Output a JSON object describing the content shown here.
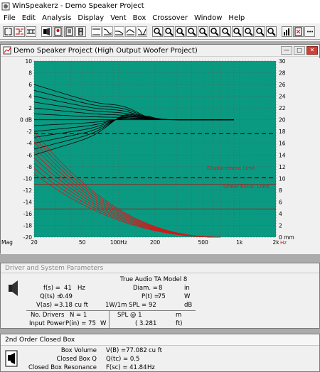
{
  "app": {
    "title": "WinSpeakerz - Demo Speaker Project"
  },
  "menu": [
    "File",
    "Edit",
    "Analysis",
    "Display",
    "Vent",
    "Box",
    "Crossover",
    "Window",
    "Help"
  ],
  "graph": {
    "window_title": "Demo Speaker Project (High Output Woofer Project)",
    "left_ticks": [
      "10",
      "8",
      "6",
      "4",
      "2",
      "0 dB",
      "-2",
      "-4",
      "-6",
      "-8",
      "-10",
      "-12",
      "-14",
      "-16",
      "-18",
      "-20"
    ],
    "left_bottom_label": "Mag",
    "right_ticks": [
      "30",
      "28",
      "26",
      "24",
      "22",
      "20",
      "18",
      "16",
      "14",
      "12",
      "10",
      "8",
      "6",
      "4",
      "2",
      "0 mm"
    ],
    "x_ticks": [
      "20",
      "50",
      "100Hz",
      "200",
      "500",
      "1k",
      "2k"
    ],
    "x_corner": "Hz",
    "annotations": [
      "Displacement Limit",
      "Linear Excur. Limit"
    ],
    "colors": {
      "plot_bg": "#0a9a82",
      "curve": "#000000",
      "excursion": "#d01818",
      "dashed": "#000000"
    }
  },
  "params": {
    "title": "Driver and System Parameters",
    "driver_name": "True Audio TA Model 8",
    "fs_label": "f(s) =",
    "fs_value": "41",
    "fs_unit": "Hz",
    "diam_label": "Diam. =",
    "diam_value": "8",
    "diam_unit": "in",
    "qts_label": "Q(ts) =",
    "qts_value": "0.49",
    "pt_label": "P(t) =",
    "pt_value": "75",
    "pt_unit": "W",
    "vas_label": "V(as) =",
    "vas_value": "3.18",
    "vas_unit": "cu ft",
    "spl_label": "1W/1m SPL =",
    "spl_value": "92",
    "spl_unit": "dB",
    "drivers_label": "No. Drivers",
    "drivers_value": "N = 1",
    "spl2_label": "SPL @ 1",
    "spl2_unit": "m",
    "input_label": "Input Power",
    "input_value": "P(in) = 75",
    "input_unit": "W",
    "spl2_value": "( 3.281",
    "spl2_unit2": "ft)"
  },
  "box": {
    "title": "2nd Order Closed Box",
    "vol_label": "Box Volume",
    "vol_value": "V(B) =77.082",
    "vol_unit": "cu ft",
    "q_label": "Closed Box Q",
    "q_value": "Q(tc) = 0.5",
    "res_label": "Closed Box Resonance",
    "res_value": "F(sc) = 41.84",
    "res_unit": "Hz"
  }
}
